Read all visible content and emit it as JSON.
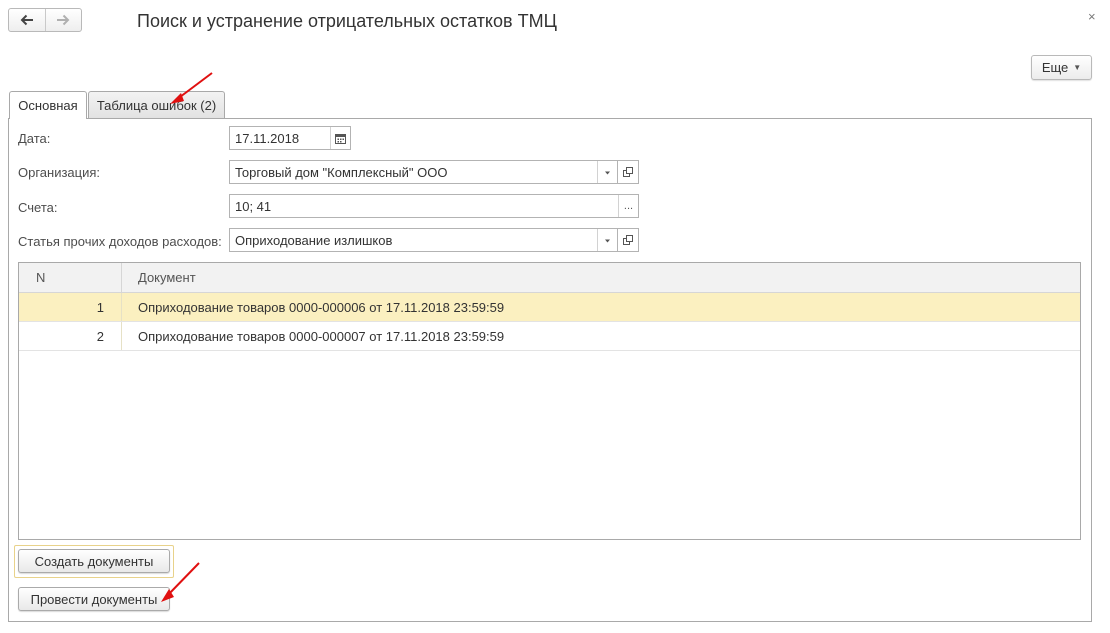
{
  "window": {
    "title": "Поиск и устранение отрицательных остатков ТМЦ",
    "close_glyph": "×",
    "more_label": "Еще",
    "more_caret": "▼"
  },
  "icons": {
    "back": "arrow-left-icon",
    "forward": "arrow-right-icon",
    "calendar": "calendar-icon",
    "dropdown": "chevron-down-icon",
    "open": "open-form-icon",
    "select": "ellipsis-icon"
  },
  "tabs": [
    {
      "label": "Основная",
      "active": true
    },
    {
      "label": "Таблица ошибок (2)",
      "active": false
    }
  ],
  "form": {
    "date": {
      "label": "Дата:",
      "value": "17.11.2018"
    },
    "organization": {
      "label": "Организация:",
      "value": "Торговый дом \"Комплексный\" ООО"
    },
    "accounts": {
      "label": "Счета:",
      "value": "10; 41",
      "button_glyph": "..."
    },
    "expense_item": {
      "label": "Статья прочих доходов расходов:",
      "value": "Оприходование излишков"
    }
  },
  "table": {
    "columns": [
      "N",
      "Документ"
    ],
    "rows": [
      {
        "n": "1",
        "doc": "Оприходование товаров 0000-000006 от 17.11.2018 23:59:59",
        "selected": true
      },
      {
        "n": "2",
        "doc": "Оприходование товаров 0000-000007 от 17.11.2018 23:59:59",
        "selected": false
      }
    ]
  },
  "buttons": {
    "create": "Создать документы",
    "post": "Провести документы"
  },
  "colors": {
    "selected_row": "#fbf0c0",
    "annotation_arrow": "#e01010",
    "focus_frame": "#e8d28a"
  }
}
